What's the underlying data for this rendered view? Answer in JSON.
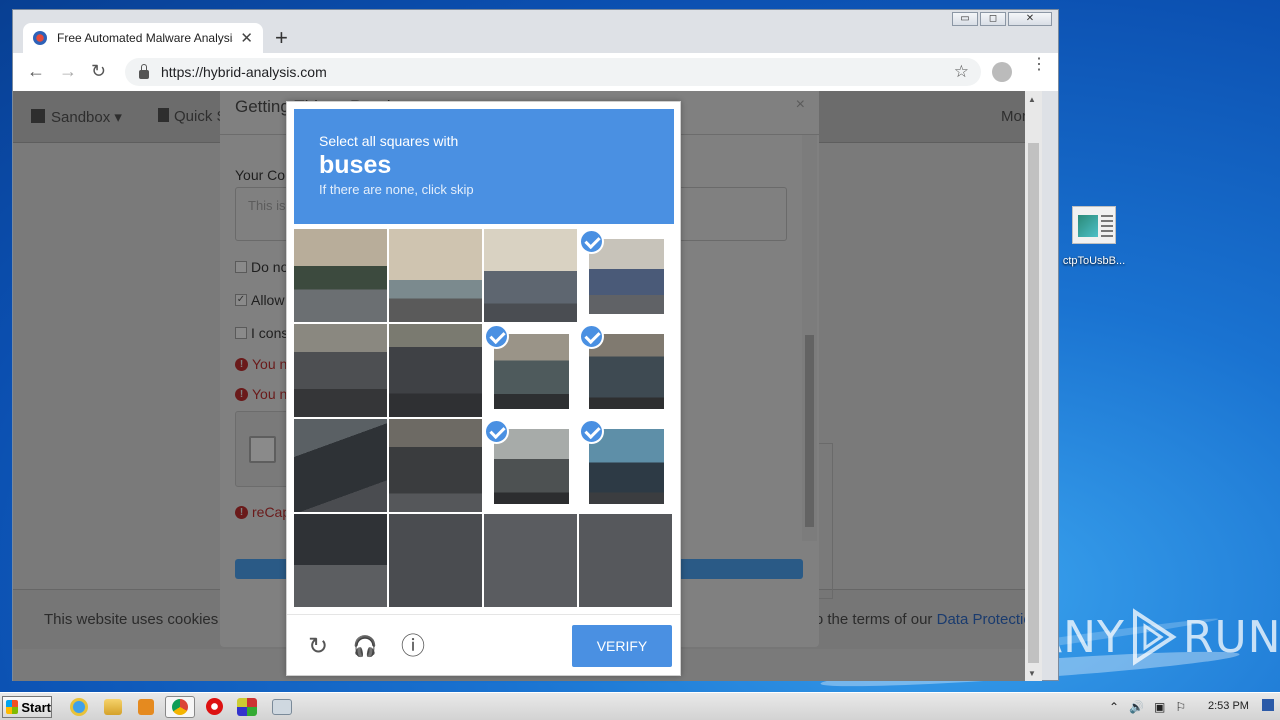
{
  "browser": {
    "tab_title": "Free Automated Malware Analysis Service",
    "tab_close": "✕",
    "new_tab": "+",
    "url": "https://hybrid-analysis.com",
    "back": "←",
    "forward": "→",
    "reload": "↻",
    "star": "☆",
    "menu": "⋮"
  },
  "window_controls": {
    "minimize": "▭",
    "maximize": "◻",
    "close": "✕"
  },
  "site_nav": {
    "sandbox": "Sandbox ▾",
    "quick_scan": "Quick S",
    "more": "More"
  },
  "modal": {
    "title": "Getting Things Ready",
    "close": "×",
    "comment_label": "Your Con",
    "comment_placeholder": "This is",
    "checkbox_1": "Do no",
    "checkbox_2": "Allow",
    "checkbox_2_mark": "✓",
    "checkbox_3": "I cons",
    "error_1": "You n",
    "error_2": "You n",
    "error_3": "reCap",
    "error_icon": "!"
  },
  "cookie": {
    "left_text": "This website uses cookies to",
    "right_text": "to the terms of our",
    "link": "Data Protection"
  },
  "captcha": {
    "line1": "Select all squares with",
    "target": "buses",
    "line3": "If there are none, click skip",
    "verify_label": "VERIFY",
    "reload_icon": "↻",
    "audio_icon": "🎧",
    "info_icon": "ⓘ",
    "tiles": [
      {
        "row": 0,
        "col": 0,
        "selected": false
      },
      {
        "row": 0,
        "col": 1,
        "selected": false
      },
      {
        "row": 0,
        "col": 2,
        "selected": false
      },
      {
        "row": 0,
        "col": 3,
        "selected": true
      },
      {
        "row": 1,
        "col": 0,
        "selected": false
      },
      {
        "row": 1,
        "col": 1,
        "selected": false
      },
      {
        "row": 1,
        "col": 2,
        "selected": true
      },
      {
        "row": 1,
        "col": 3,
        "selected": true
      },
      {
        "row": 2,
        "col": 0,
        "selected": false
      },
      {
        "row": 2,
        "col": 1,
        "selected": false
      },
      {
        "row": 2,
        "col": 2,
        "selected": true
      },
      {
        "row": 2,
        "col": 3,
        "selected": true
      },
      {
        "row": 3,
        "col": 0,
        "selected": false
      },
      {
        "row": 3,
        "col": 1,
        "selected": false
      },
      {
        "row": 3,
        "col": 2,
        "selected": false
      },
      {
        "row": 3,
        "col": 3,
        "selected": false
      }
    ]
  },
  "desktop": {
    "icon_label": "ctpToUsbB...",
    "watermark_left": "ANY",
    "watermark_right": "RUN"
  },
  "taskbar": {
    "start_label": "Start",
    "clock": "2:53 PM"
  }
}
